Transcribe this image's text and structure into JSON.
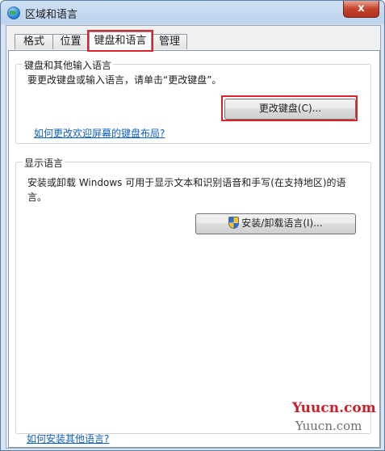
{
  "window": {
    "title": "区域和语言",
    "close_label": "x"
  },
  "tabs": [
    "格式",
    "位置",
    "键盘和语言",
    "管理"
  ],
  "keyboard_group": {
    "title": "键盘和其他输入语言",
    "description": "要更改键盘或输入语言，请单击“更改键盘”。",
    "button_label": "更改键盘(C)...",
    "link": "如何更改欢迎屏幕的键盘布局?"
  },
  "display_group": {
    "title": "显示语言",
    "description_line1": "安装或卸载 Windows 可用于显示文本和识别语音和手写(在支持地区)的语",
    "description_line2": "言。",
    "button_label": "安装/卸载语言(I)..."
  },
  "footer_link": "如何安装其他语言?",
  "watermark": {
    "line1": "Yuucn.com",
    "line2": "Yuucn.com"
  }
}
